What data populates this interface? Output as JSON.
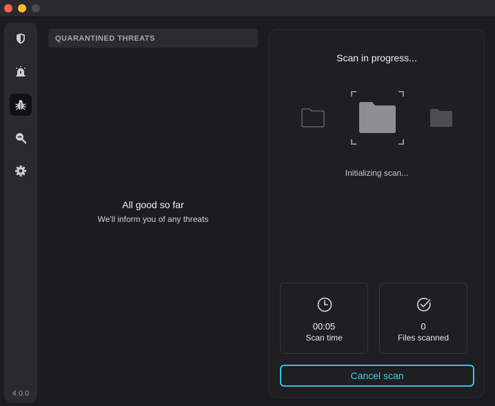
{
  "window": {
    "controls": [
      "close",
      "minimize",
      "maximize"
    ]
  },
  "sidebar": {
    "items": [
      {
        "icon": "shield-icon",
        "active": false
      },
      {
        "icon": "alarm-icon",
        "active": false
      },
      {
        "icon": "bug-icon",
        "active": true
      },
      {
        "icon": "search-minus-icon",
        "active": false
      },
      {
        "icon": "gear-icon",
        "active": false
      }
    ],
    "version": "4.0.0"
  },
  "quarantine": {
    "header": "QUARANTINED THREATS",
    "empty_title": "All good so far",
    "empty_subtitle": "We'll inform you of any threats"
  },
  "scan": {
    "title": "Scan in progress...",
    "status": "Initializing scan...",
    "scan_time": {
      "value": "00:05",
      "label": "Scan time"
    },
    "files_scanned": {
      "value": "0",
      "label": "Files scanned"
    },
    "cancel_label": "Cancel scan"
  },
  "colors": {
    "accent": "#2ec6e6",
    "background": "#1c1c1e",
    "sidebar": "#2a2a2d"
  }
}
